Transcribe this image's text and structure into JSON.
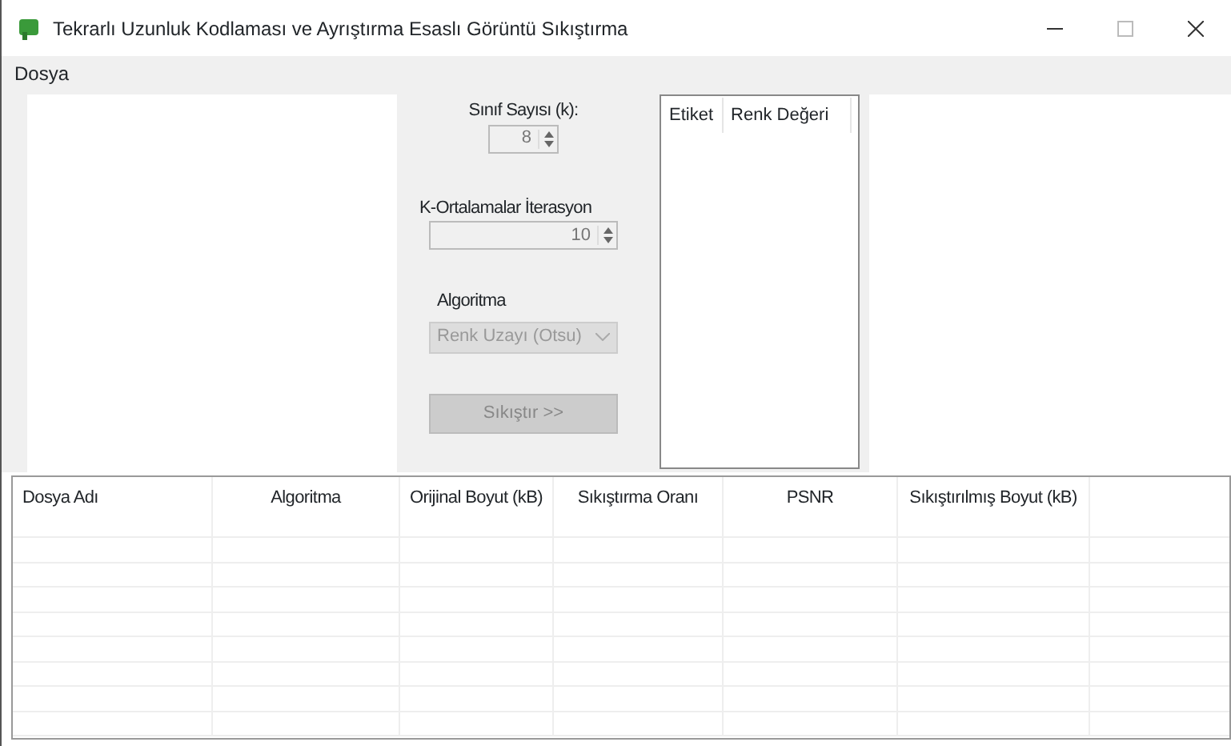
{
  "window": {
    "title": "Tekrarlı Uzunluk Kodlaması ve Ayrıştırma Esaslı Görüntü Sıkıştırma"
  },
  "menu": [
    "Dosya"
  ],
  "controls": {
    "class_count": {
      "label": "Sınıf Sayısı (k):",
      "value": "8",
      "disabled": true
    },
    "iterations": {
      "label": "K-Ortalamalar İterasyon",
      "value": "10",
      "disabled": true
    },
    "algorithm": {
      "label": "Algoritma",
      "value": "Renk Uzayı (Otsu)",
      "disabled": true
    },
    "compress_button": {
      "label": "Sıkıştır >>",
      "disabled": true
    }
  },
  "palette_list": {
    "columns": [
      "Etiket",
      "Renk Değeri"
    ]
  },
  "results_table": {
    "columns": [
      "Dosya Adı",
      "Algoritma",
      "Orijinal Boyut (kB)",
      "Sıkıştırma Oranı",
      "PSNR",
      "Sıkıştırılmış Boyut (kB)"
    ]
  }
}
